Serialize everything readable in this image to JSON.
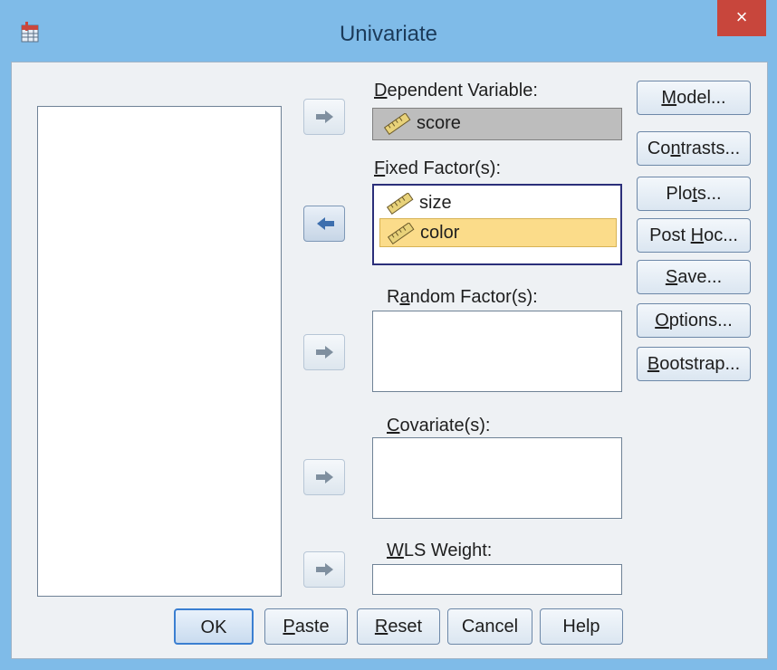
{
  "window": {
    "title": "Univariate",
    "close_glyph": "×"
  },
  "source_list": {
    "items": []
  },
  "dependent": {
    "label_prefix": "",
    "label_u": "D",
    "label_rest": "ependent Variable:",
    "value": "score"
  },
  "fixed": {
    "label_u": "F",
    "label_rest": "ixed Factor(s):",
    "items": [
      "size",
      "color"
    ],
    "selected_index": 1
  },
  "random": {
    "label_pre": "R",
    "label_u": "a",
    "label_rest": "ndom Factor(s):"
  },
  "covariate": {
    "label_u": "C",
    "label_rest": "ovariate(s):"
  },
  "wls": {
    "label_u": "W",
    "label_rest": "LS Weight:"
  },
  "side_buttons": {
    "model": {
      "pre": "",
      "u": "M",
      "post": "odel..."
    },
    "contrasts": {
      "pre": "Co",
      "u": "n",
      "post": "trasts..."
    },
    "plots": {
      "pre": "Plo",
      "u": "t",
      "post": "s..."
    },
    "posthoc": {
      "pre": "Post ",
      "u": "H",
      "post": "oc..."
    },
    "save": {
      "pre": "",
      "u": "S",
      "post": "ave..."
    },
    "options": {
      "pre": "",
      "u": "O",
      "post": "ptions..."
    },
    "bootstrap": {
      "pre": "",
      "u": "B",
      "post": "ootstrap..."
    }
  },
  "bottom_buttons": {
    "ok": {
      "pre": "OK",
      "u": "",
      "post": ""
    },
    "paste": {
      "pre": "",
      "u": "P",
      "post": "aste"
    },
    "reset": {
      "pre": "",
      "u": "R",
      "post": "eset"
    },
    "cancel": {
      "pre": "Cancel",
      "u": "",
      "post": ""
    },
    "help": {
      "pre": "Help",
      "u": "",
      "post": ""
    }
  },
  "icons": {
    "app": "spss-app-icon",
    "ruler": "scale-ruler-icon",
    "arrow_right": "arrow-right-icon",
    "arrow_left": "arrow-left-icon"
  },
  "colors": {
    "selection": "#fbdc8a",
    "frame": "#7fbbe8",
    "close": "#c8463c"
  }
}
